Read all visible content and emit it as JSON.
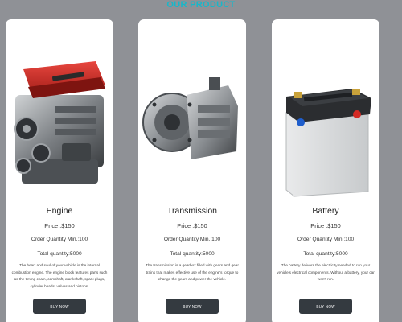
{
  "section_title": "OUR PRODUCT",
  "products": [
    {
      "name": "Engine",
      "price": "Price :$150",
      "order_quantity": "Order Quantity Min.:100",
      "total_quantity": "Total quantity:5000",
      "description": "The heart and soul of your vehicle is the internal combustion engine. The engine block features parts such as the timing chain, camshaft, crankshaft, spark plugs, cylinder heads, valves and pistons.",
      "button_label": "BUY NOW",
      "icon": "engine-icon"
    },
    {
      "name": "Transmission",
      "price": "Price :$150",
      "order_quantity": "Order Quantity Min.:100",
      "total_quantity": "Total quantity:5000",
      "description": "The transmission is a gearbox filled with gears and gear trains that makes effective use of the engine's torque to change the gears and power the vehicle.",
      "button_label": "BUY NOW",
      "icon": "transmission-icon"
    },
    {
      "name": "Battery",
      "price": "Price :$150",
      "order_quantity": "Order Quantity Min.:100",
      "total_quantity": "Total quantity:5000",
      "description": "The battery delivers the electricity needed to run your vehicle's electrical components. Without a battery, your car won't run.",
      "button_label": "BUY NOW",
      "icon": "battery-icon"
    }
  ],
  "colors": {
    "background": "#8f9196",
    "title": "#18b7c9",
    "card": "#ffffff",
    "button": "#343a40",
    "engine_cover": "#d42a24"
  }
}
